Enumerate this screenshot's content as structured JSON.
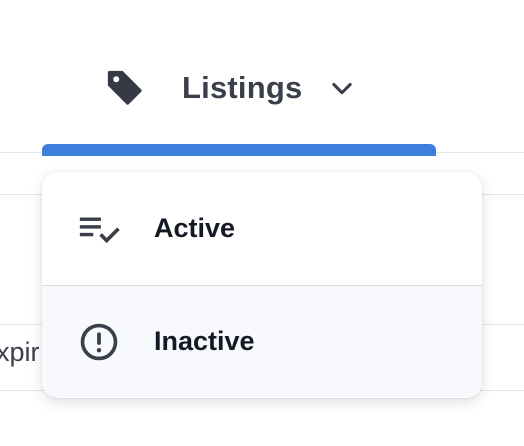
{
  "tab": {
    "label": "Listings",
    "icon": "tag-icon"
  },
  "accent_color": "#3f7fdc",
  "background": {
    "partial_text": "xpir"
  },
  "menu": {
    "items": [
      {
        "label": "Active",
        "icon": "checklist-icon"
      },
      {
        "label": "Inactive",
        "icon": "alert-circle-icon"
      }
    ]
  }
}
